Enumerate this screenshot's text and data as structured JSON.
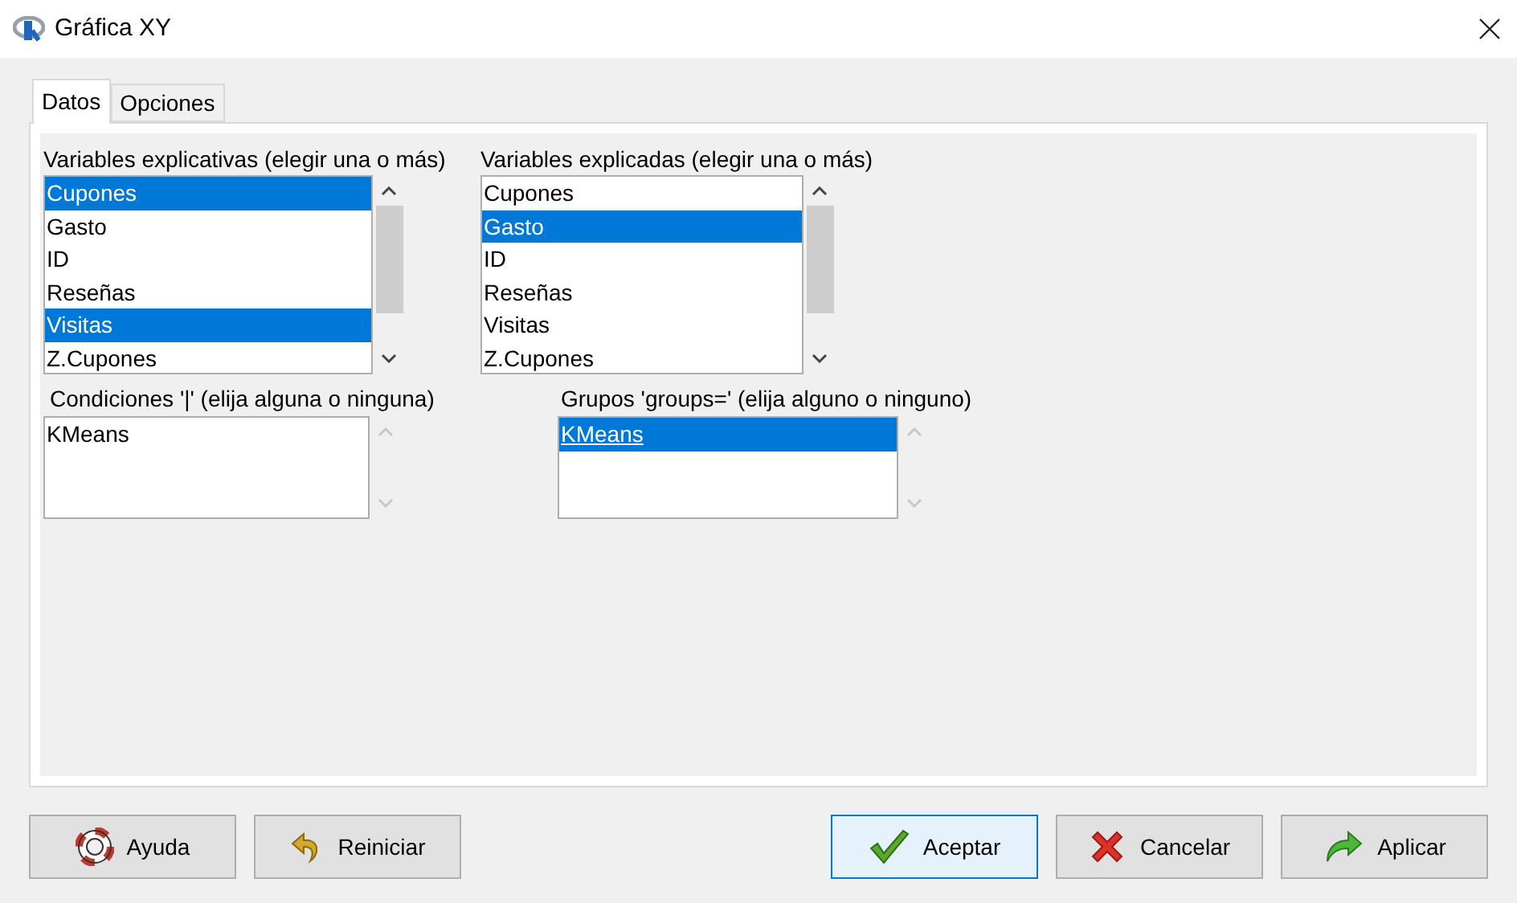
{
  "window": {
    "title": "Gráfica XY"
  },
  "tabs": [
    {
      "label": "Datos",
      "selected": true
    },
    {
      "label": "Opciones",
      "selected": false
    }
  ],
  "lists": [
    {
      "label": "Variables explicativas (elegir una o más)",
      "scrollable": true,
      "items": [
        {
          "text": "Cupones",
          "selected": true,
          "focused": false
        },
        {
          "text": "Gasto",
          "selected": false,
          "focused": false
        },
        {
          "text": "ID",
          "selected": false,
          "focused": false
        },
        {
          "text": "Reseñas",
          "selected": false,
          "focused": false
        },
        {
          "text": "Visitas",
          "selected": true,
          "focused": false
        },
        {
          "text": "Z.Cupones",
          "selected": false,
          "focused": false
        }
      ]
    },
    {
      "label": "Variables explicadas (elegir una o más)",
      "scrollable": true,
      "items": [
        {
          "text": "Cupones",
          "selected": false,
          "focused": false
        },
        {
          "text": "Gasto",
          "selected": true,
          "focused": false
        },
        {
          "text": "ID",
          "selected": false,
          "focused": false
        },
        {
          "text": "Reseñas",
          "selected": false,
          "focused": false
        },
        {
          "text": "Visitas",
          "selected": false,
          "focused": false
        },
        {
          "text": "Z.Cupones",
          "selected": false,
          "focused": false
        }
      ]
    },
    {
      "label": "Condiciones '|' (elija alguna o ninguna)",
      "scrollable": false,
      "items": [
        {
          "text": "KMeans",
          "selected": false,
          "focused": false
        }
      ]
    },
    {
      "label": "Grupos 'groups=' (elija alguno o ninguno)",
      "scrollable": false,
      "items": [
        {
          "text": "KMeans",
          "selected": true,
          "focused": true
        }
      ]
    }
  ],
  "buttons": [
    {
      "label": "Ayuda",
      "kind": "help",
      "focused": false
    },
    {
      "label": "Reiniciar",
      "kind": "reset",
      "focused": false
    },
    {
      "label": "Aceptar",
      "kind": "ok",
      "focused": true
    },
    {
      "label": "Cancelar",
      "kind": "cancel",
      "focused": false
    },
    {
      "label": "Aplicar",
      "kind": "apply",
      "focused": false
    }
  ]
}
